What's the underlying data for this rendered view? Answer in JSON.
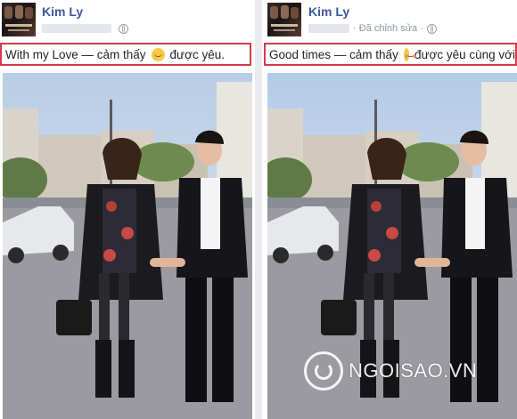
{
  "posts": {
    "left": {
      "author": "Kim Ly",
      "meta_edited": "",
      "feeling_text": "With my Love — cảm thấy",
      "feeling_tail": "được yêu.",
      "emoji": "smiling-face-icon"
    },
    "right": {
      "author": "Kim Ly",
      "meta_edited": "· Đã chỉnh sửa ·",
      "feeling_text": "Good times — cảm thấy",
      "feeling_tail": "được yêu cùng với",
      "emoji": "blushing-face-icon"
    }
  },
  "watermark": {
    "text": "NGOISAO.VN"
  },
  "colors": {
    "highlight_border": "#d7394b",
    "author_link": "#3b5998",
    "separator": "#e9ebee"
  }
}
